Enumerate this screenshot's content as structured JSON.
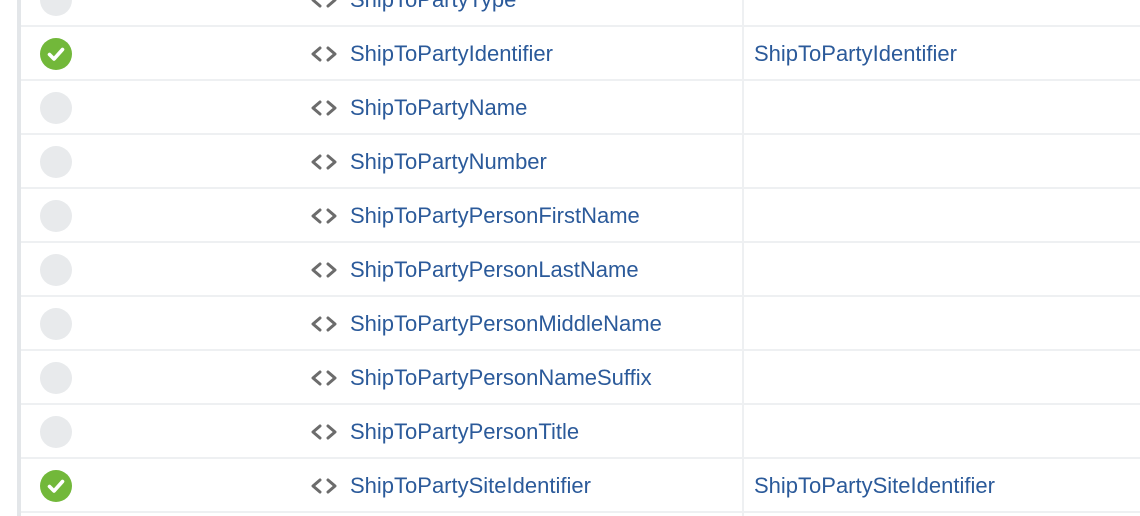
{
  "icons": {
    "status_mapped": "check-circle-icon",
    "status_unmapped": "empty-circle-icon",
    "element": "code-brackets-icon"
  },
  "colors": {
    "mapped": "#72b83a",
    "unmapped": "#e8eaec",
    "link": "#2b5a9a"
  },
  "rows": [
    {
      "mapped": false,
      "name": "ShipToPartyType",
      "mapping": ""
    },
    {
      "mapped": true,
      "name": "ShipToPartyIdentifier",
      "mapping": "ShipToPartyIdentifier"
    },
    {
      "mapped": false,
      "name": "ShipToPartyName",
      "mapping": ""
    },
    {
      "mapped": false,
      "name": "ShipToPartyNumber",
      "mapping": ""
    },
    {
      "mapped": false,
      "name": "ShipToPartyPersonFirstName",
      "mapping": ""
    },
    {
      "mapped": false,
      "name": "ShipToPartyPersonLastName",
      "mapping": ""
    },
    {
      "mapped": false,
      "name": "ShipToPartyPersonMiddleName",
      "mapping": ""
    },
    {
      "mapped": false,
      "name": "ShipToPartyPersonNameSuffix",
      "mapping": ""
    },
    {
      "mapped": false,
      "name": "ShipToPartyPersonTitle",
      "mapping": ""
    },
    {
      "mapped": true,
      "name": "ShipToPartySiteIdentifier",
      "mapping": "ShipToPartySiteIdentifier"
    }
  ]
}
